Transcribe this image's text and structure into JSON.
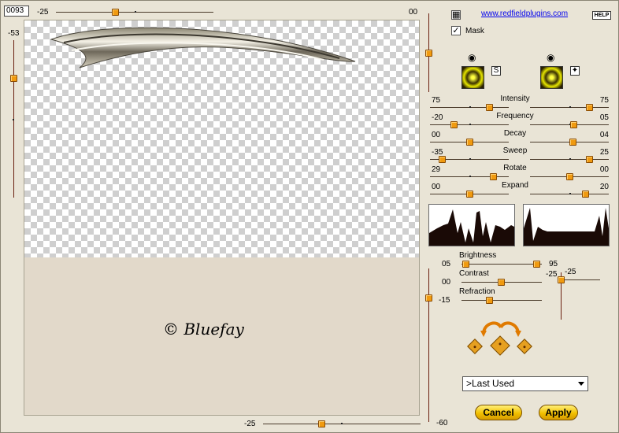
{
  "header": {
    "number_box": "0093",
    "top_slider_value": "-25",
    "top_right_value": "00",
    "left_slider_value": "-53",
    "link_text": "www.redfieldplugins.com",
    "help_label": "HELP",
    "mask_label": "Mask",
    "mask_checked": true
  },
  "preview": {
    "watermark": "© Bluefay"
  },
  "wave_controls": [
    {
      "label": "Intensity",
      "left_value": "75",
      "right_value": "75"
    },
    {
      "label": "Frequency",
      "left_value": "-20",
      "right_value": "05"
    },
    {
      "label": "Decay",
      "left_value": "00",
      "right_value": "04"
    },
    {
      "label": "Sweep",
      "left_value": "-35",
      "right_value": "25"
    },
    {
      "label": "Rotate",
      "left_value": "29",
      "right_value": "00"
    },
    {
      "label": "Expand",
      "left_value": "00",
      "right_value": "20"
    }
  ],
  "light_controls": {
    "brightness": {
      "label": "Brightness",
      "left_value": "05",
      "right_value": "95"
    },
    "contrast": {
      "label": "Contrast",
      "left_value": "00",
      "right_value": "-25"
    },
    "refraction": {
      "label": "Refraction",
      "left_value": "-15"
    },
    "side_value": "-25"
  },
  "bottom": {
    "slider_value": "-25",
    "vertical_slider_value": "-60",
    "preset_selected": ">Last Used",
    "cancel_label": "Cancel",
    "apply_label": "Apply"
  },
  "colors": {
    "accent": "#f09a10",
    "window_bg": "#e9e4d6",
    "preview_bg": "#e2d9ca",
    "swatch_yellow": "#e6e600"
  }
}
